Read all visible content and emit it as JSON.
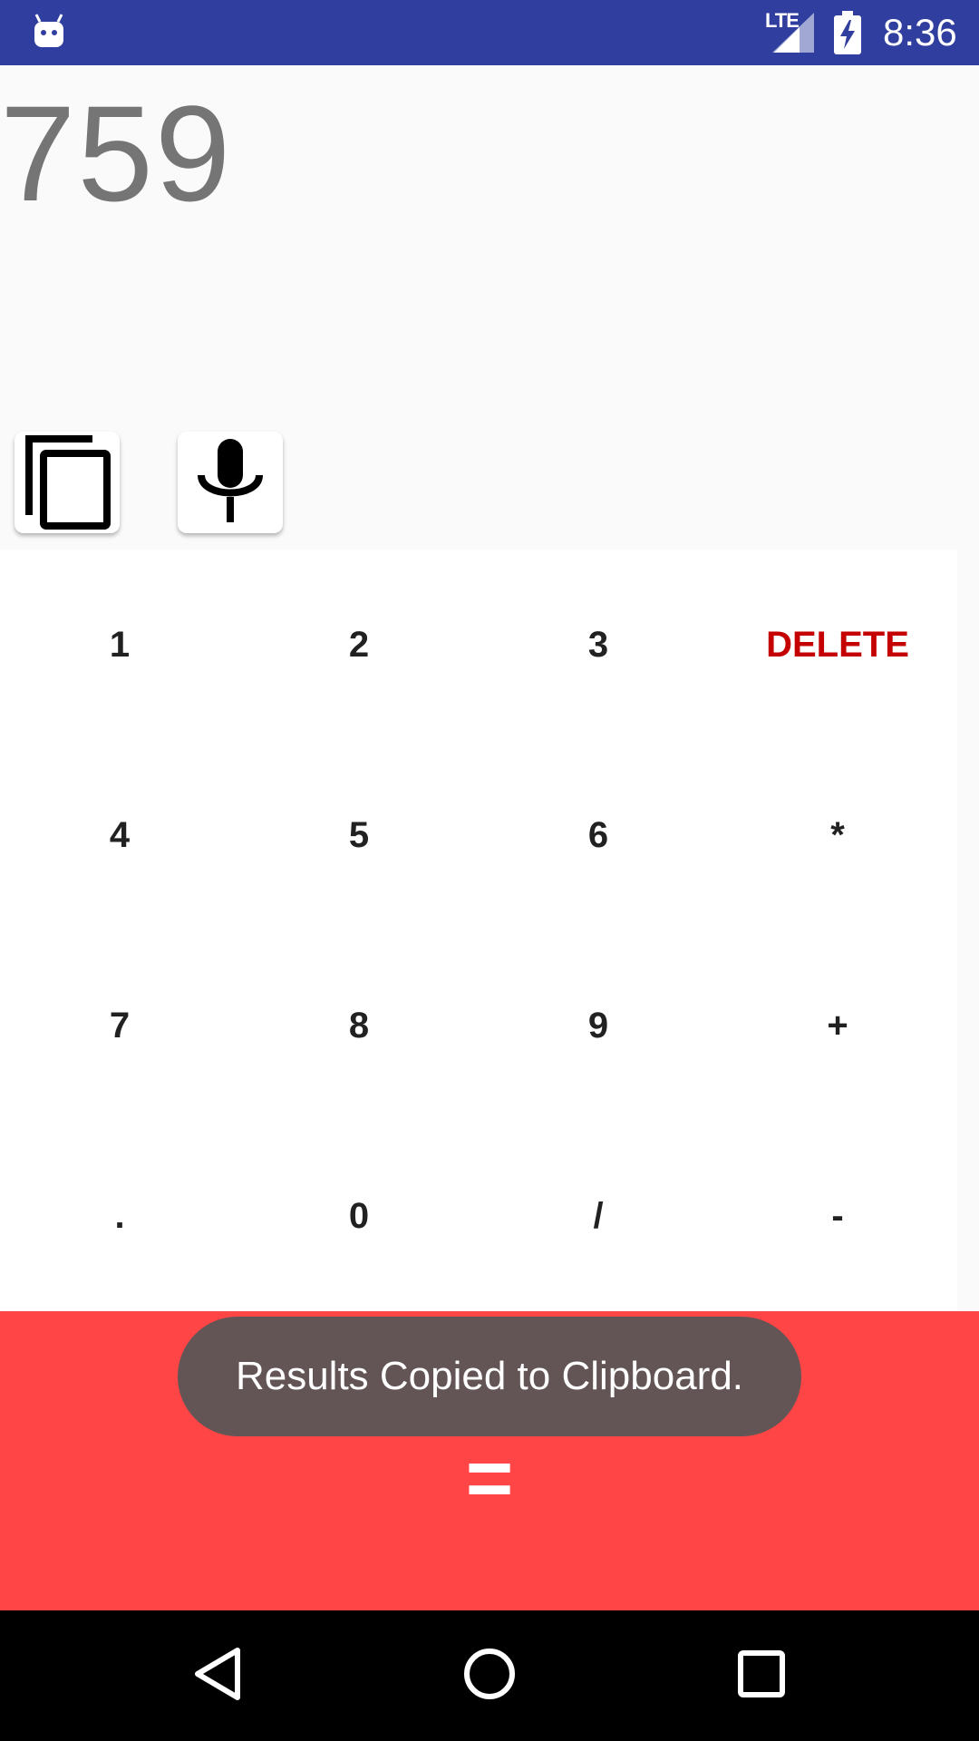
{
  "status_bar": {
    "network": "LTE",
    "time": "8:36",
    "icons": [
      "android-icon",
      "signal-icon",
      "battery-charging-icon"
    ]
  },
  "display": {
    "result": "759"
  },
  "toolbar": {
    "copy_icon": "copy-icon",
    "mic_icon": "microphone-icon"
  },
  "keypad": {
    "keys": [
      "1",
      "2",
      "3",
      "DELETE",
      "4",
      "5",
      "6",
      "*",
      "7",
      "8",
      "9",
      "+",
      ".",
      "0",
      "/",
      "-"
    ]
  },
  "equals_label": "=",
  "toast": {
    "message": "Results Copied to Clipboard."
  },
  "colors": {
    "status_bar": "#303f9f",
    "delete": "#c40000",
    "equals_bg": "#ff4545",
    "toast_bg": "#635555"
  },
  "nav_bar": {
    "icons": [
      "back-icon",
      "home-icon",
      "recents-icon"
    ]
  }
}
